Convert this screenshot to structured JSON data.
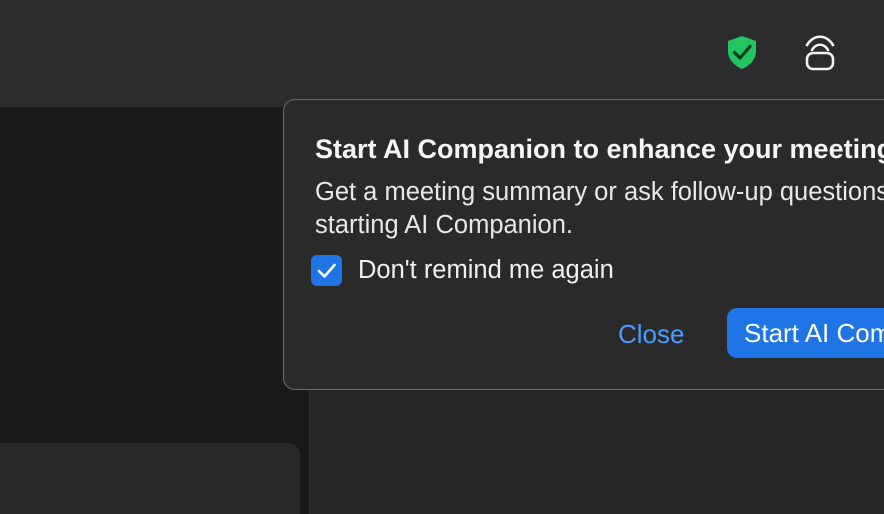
{
  "header": {
    "security_icon": "shield-check-icon",
    "security_color": "#23c55e",
    "sync_icon": "signal-sync-icon"
  },
  "ai_popover": {
    "title": "Start AI Companion to enhance your meeting",
    "body": "Get a meeting summary or ask follow-up questions by starting AI Companion.",
    "body_line1": "Get a meeting summary or ask follow-up questions by",
    "body_line2": "starting AI Companion.",
    "checkbox_label": "Don't remind me again",
    "checkbox_checked": true,
    "close_label": "Close",
    "start_label": "Start AI Companion",
    "accent_color": "#1f74e6",
    "link_color": "#4c9aff"
  }
}
